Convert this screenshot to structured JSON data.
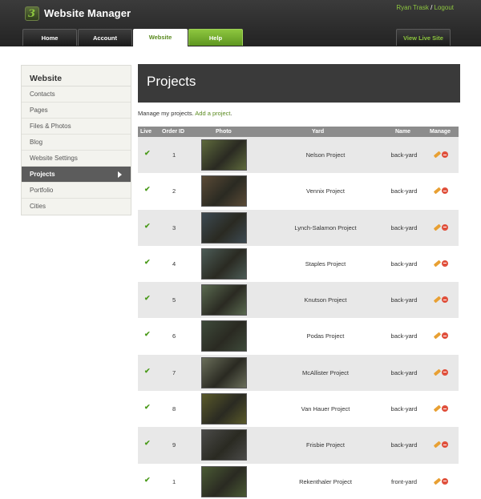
{
  "app": {
    "title": "Website Manager",
    "logo_icon": "leaf-logo-icon"
  },
  "user": {
    "name": "Ryan Trask",
    "separator": "/",
    "logout": "Logout"
  },
  "nav": {
    "tabs": [
      {
        "label": "Home"
      },
      {
        "label": "Account"
      },
      {
        "label": "Website",
        "active": true
      },
      {
        "label": "Help"
      }
    ],
    "view_live": "View Live Site"
  },
  "sidebar": {
    "heading": "Website",
    "items": [
      {
        "label": "Contacts"
      },
      {
        "label": "Pages"
      },
      {
        "label": "Files & Photos"
      },
      {
        "label": "Blog"
      },
      {
        "label": "Website Settings"
      },
      {
        "label": "Projects",
        "active": true
      },
      {
        "label": "Portfolio"
      },
      {
        "label": "Cities"
      }
    ]
  },
  "main": {
    "title": "Projects",
    "intro_text": "Manage my projects.",
    "add_link": "Add a project",
    "intro_end": "."
  },
  "table": {
    "columns": [
      "Live",
      "Order ID",
      "Photo",
      "Yard",
      "Name",
      "Manage"
    ],
    "rows": [
      {
        "live": "✔",
        "order": "1",
        "yard": "Nelson Project",
        "name": "back-yard",
        "photo_color": "#5e6a3c"
      },
      {
        "live": "✔",
        "order": "2",
        "yard": "Vennix Project",
        "name": "back-yard",
        "photo_color": "#5a4a36"
      },
      {
        "live": "✔",
        "order": "3",
        "yard": "Lynch-Salamon Project",
        "name": "back-yard",
        "photo_color": "#3d4a52"
      },
      {
        "live": "✔",
        "order": "4",
        "yard": "Staples Project",
        "name": "back-yard",
        "photo_color": "#4c5c56"
      },
      {
        "live": "✔",
        "order": "5",
        "yard": "Knutson Project",
        "name": "back-yard",
        "photo_color": "#5a6a50"
      },
      {
        "live": "✔",
        "order": "6",
        "yard": "Podas Project",
        "name": "back-yard",
        "photo_color": "#3e4a3a"
      },
      {
        "live": "✔",
        "order": "7",
        "yard": "McAllister Project",
        "name": "back-yard",
        "photo_color": "#6a6e5a"
      },
      {
        "live": "✔",
        "order": "8",
        "yard": "Van Hauer Project",
        "name": "back-yard",
        "photo_color": "#5a5a2a"
      },
      {
        "live": "✔",
        "order": "9",
        "yard": "Frisbie Project",
        "name": "back-yard",
        "photo_color": "#4a4a48"
      },
      {
        "live": "✔",
        "order": "1",
        "yard": "Rekenthaler Project",
        "name": "front-yard",
        "photo_color": "#4a5a34"
      }
    ]
  },
  "colors": {
    "accent_green": "#8dc63f",
    "header_dark": "#2e2e2e",
    "banner": "#3a3a3a",
    "table_header": "#8c8c8c"
  },
  "icons": {
    "live": "checkmark-icon",
    "edit": "pencil-icon",
    "delete": "delete-icon",
    "active_arrow": "triangle-right-icon"
  }
}
